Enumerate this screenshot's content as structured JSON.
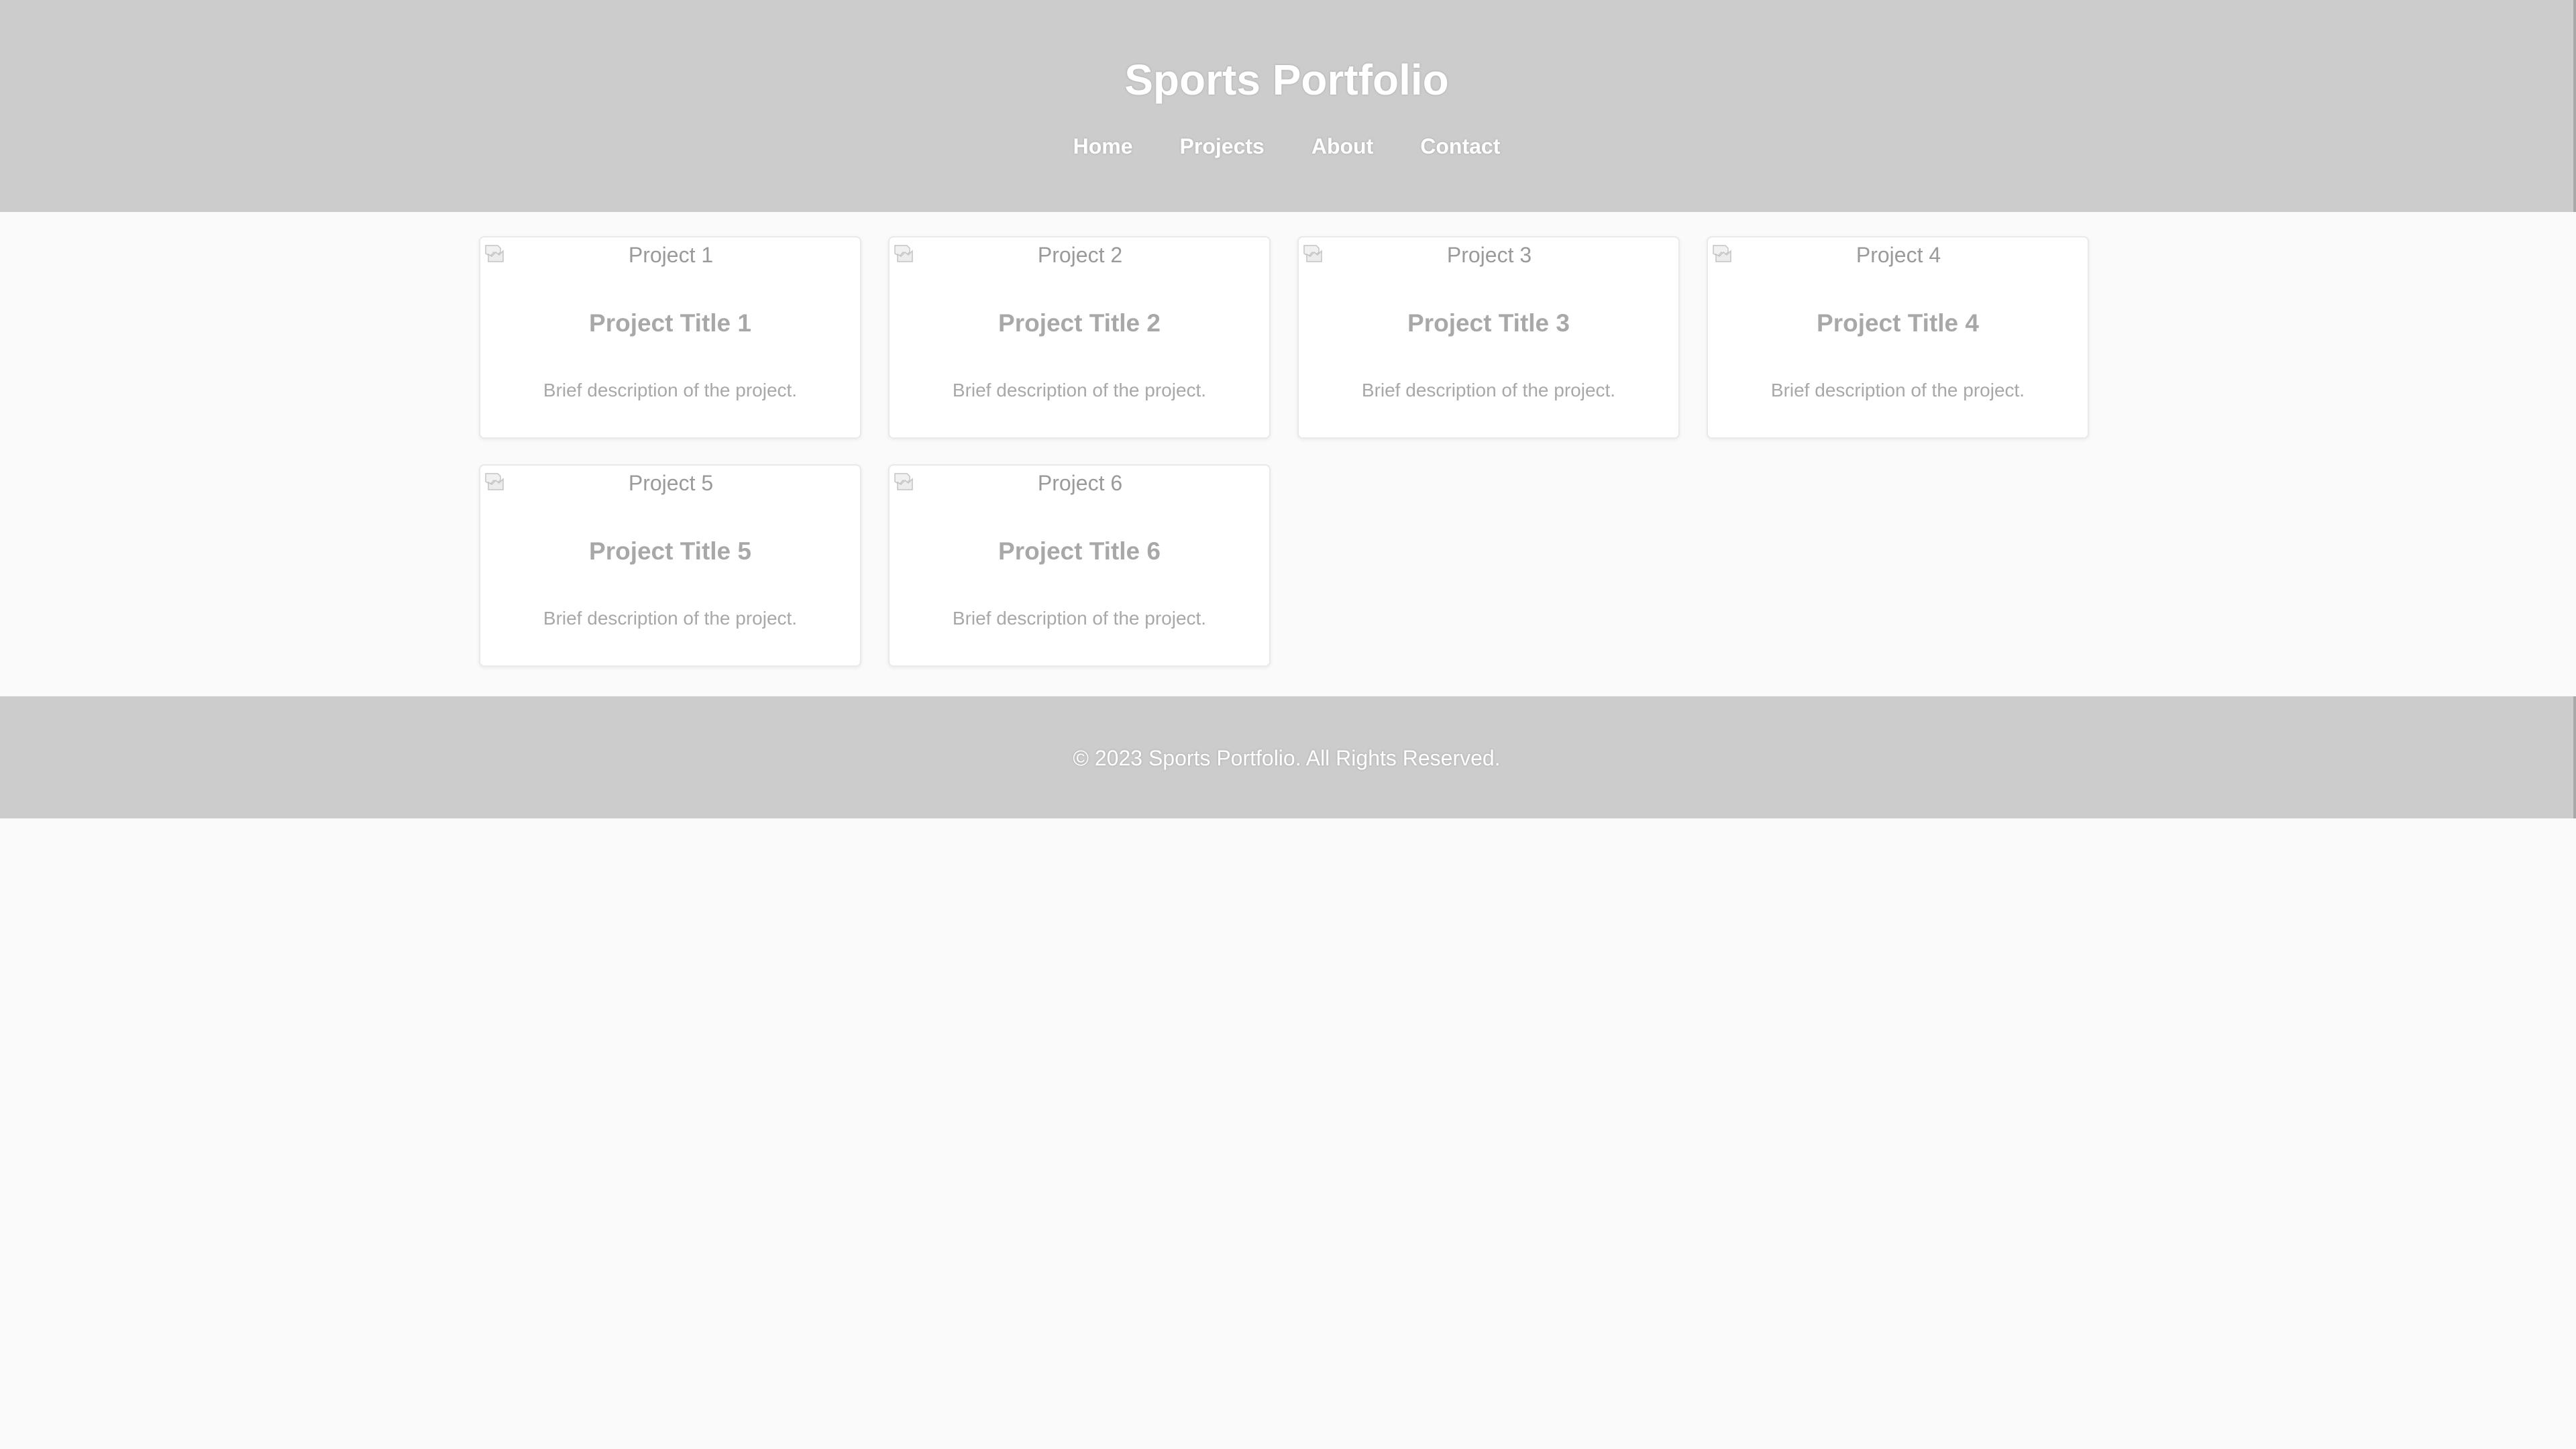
{
  "header": {
    "title": "Sports Portfolio",
    "nav": [
      {
        "label": "Home"
      },
      {
        "label": "Projects"
      },
      {
        "label": "About"
      },
      {
        "label": "Contact"
      }
    ]
  },
  "projects": [
    {
      "image_alt": "Project 1",
      "title": "Project Title 1",
      "description": "Brief description of the project."
    },
    {
      "image_alt": "Project 2",
      "title": "Project Title 2",
      "description": "Brief description of the project."
    },
    {
      "image_alt": "Project 3",
      "title": "Project Title 3",
      "description": "Brief description of the project."
    },
    {
      "image_alt": "Project 4",
      "title": "Project Title 4",
      "description": "Brief description of the project."
    },
    {
      "image_alt": "Project 5",
      "title": "Project Title 5",
      "description": "Brief description of the project."
    },
    {
      "image_alt": "Project 6",
      "title": "Project Title 6",
      "description": "Brief description of the project."
    }
  ],
  "footer": {
    "text": "© 2023 Sports Portfolio. All Rights Reserved."
  },
  "colors": {
    "header_bg": "#cccccc",
    "footer_bg": "#cccccc",
    "page_bg": "#fafafa",
    "card_bg": "#ffffff",
    "muted_text": "#a8a8a8"
  },
  "icons": {
    "broken_image": "broken-image-icon"
  }
}
